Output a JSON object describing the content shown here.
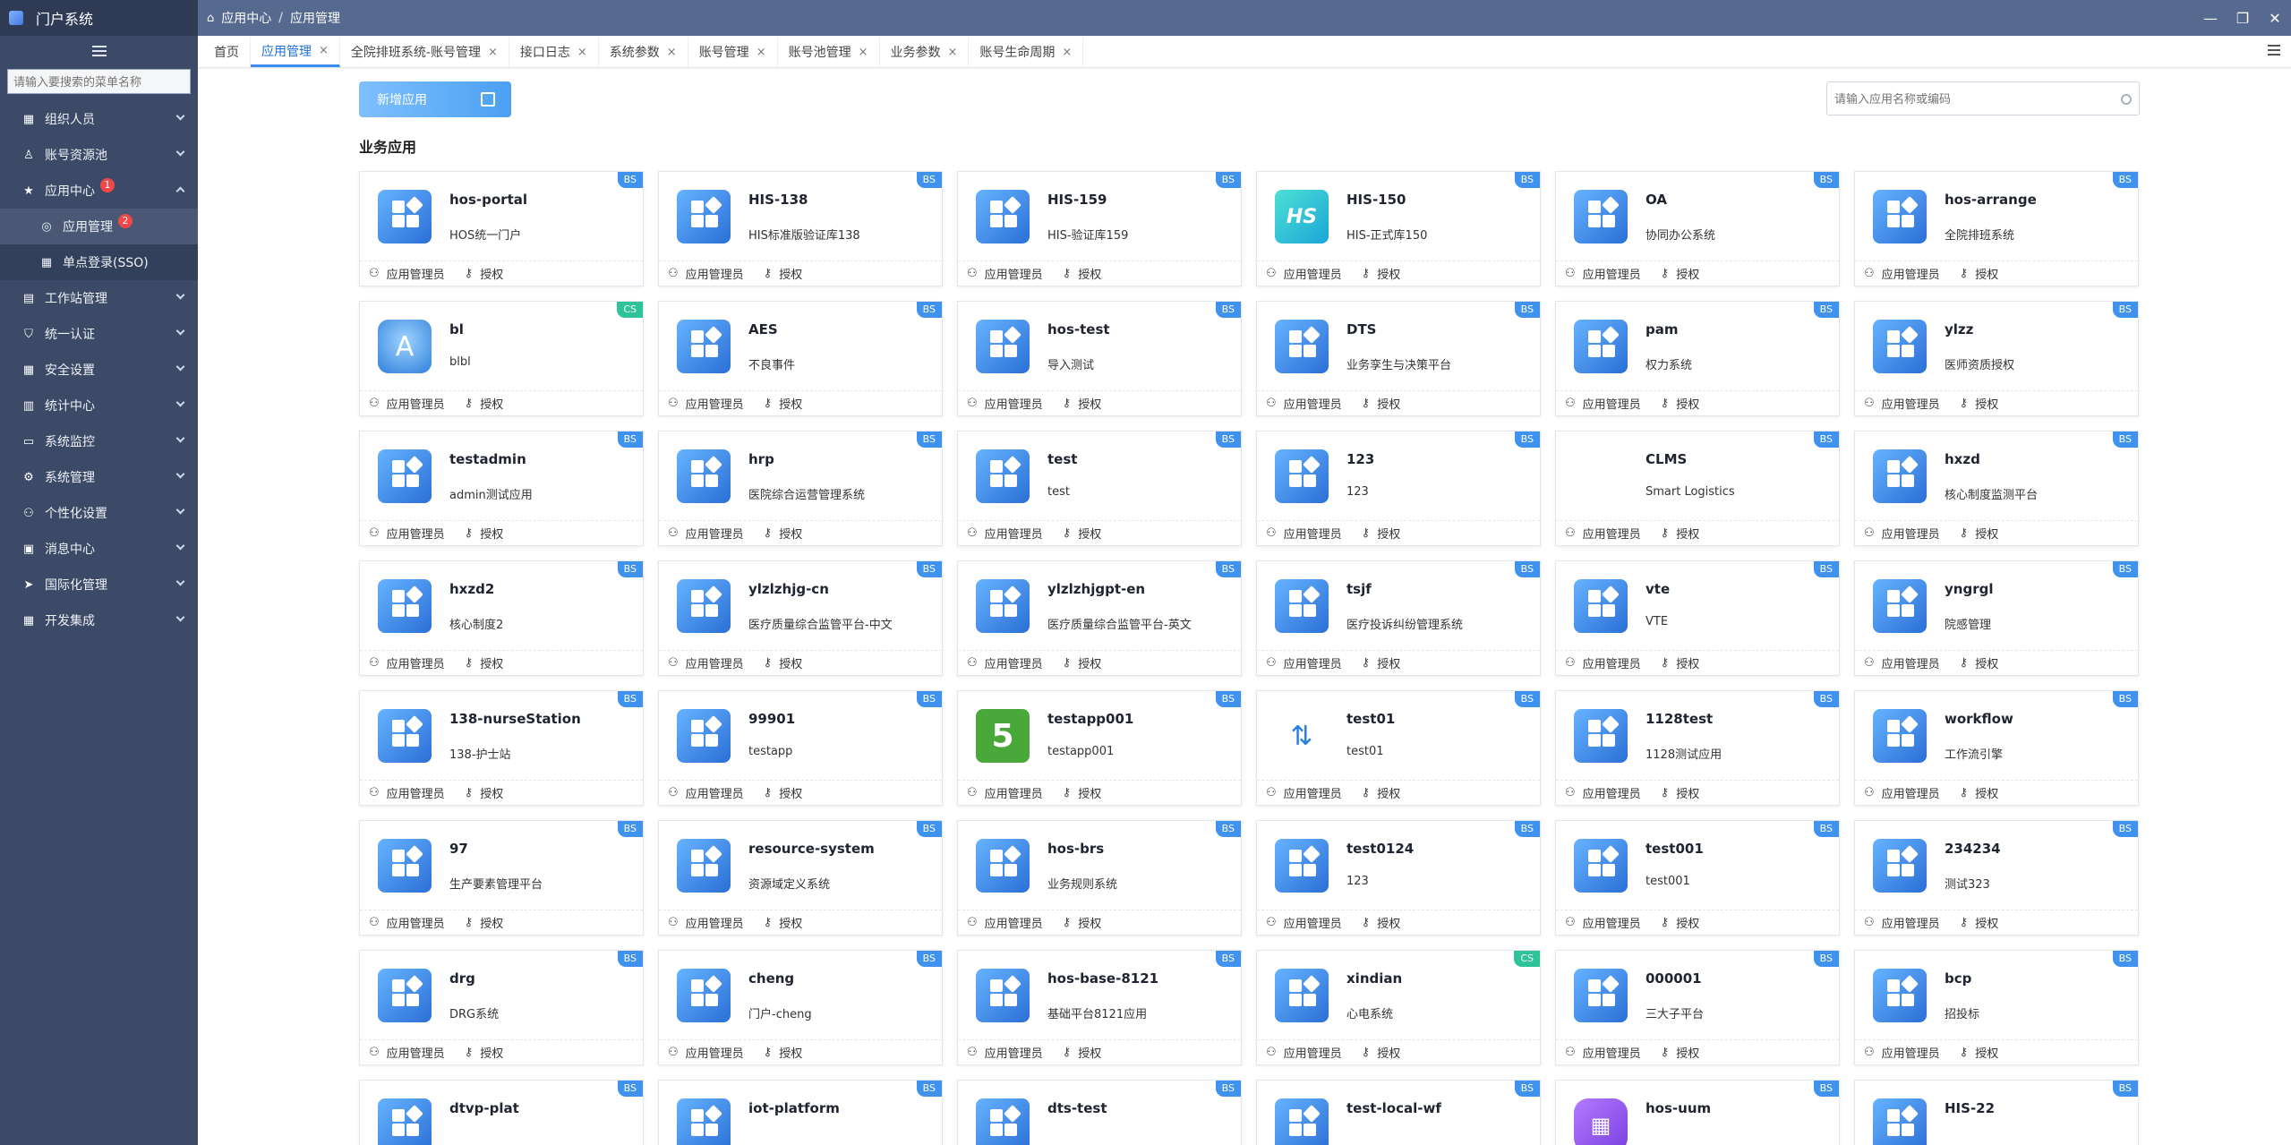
{
  "app": {
    "title": "门户系统"
  },
  "sidebar": {
    "search_placeholder": "请输入要搜索的菜单名称",
    "items": [
      {
        "label": "组织人员",
        "icon": "grid-icon"
      },
      {
        "label": "账号资源池",
        "icon": "user-icon"
      },
      {
        "label": "应用中心",
        "icon": "star-icon",
        "badge": "1"
      },
      {
        "label": "工作站管理",
        "icon": "document-icon"
      },
      {
        "label": "统一认证",
        "icon": "shield-icon"
      },
      {
        "label": "安全设置",
        "icon": "grid-icon"
      },
      {
        "label": "统计中心",
        "icon": "chart-icon"
      },
      {
        "label": "系统监控",
        "icon": "monitor-icon"
      },
      {
        "label": "系统管理",
        "icon": "settings-icon"
      },
      {
        "label": "个性化设置",
        "icon": "people-icon"
      },
      {
        "label": "消息中心",
        "icon": "inbox-icon"
      },
      {
        "label": "国际化管理",
        "icon": "send-icon"
      },
      {
        "label": "开发集成",
        "icon": "grid-icon"
      }
    ],
    "sub_items": [
      {
        "label": "应用管理",
        "icon": "app-icon",
        "badge": "2"
      },
      {
        "label": "单点登录(SSO)",
        "icon": "grid-icon"
      }
    ]
  },
  "breadcrumb": {
    "level1": "应用中心",
    "sep": "/",
    "level2": "应用管理"
  },
  "tabs": [
    {
      "label": "首页",
      "closable": false
    },
    {
      "label": "应用管理",
      "closable": true
    },
    {
      "label": "全院排班系统-账号管理",
      "closable": true
    },
    {
      "label": "接口日志",
      "closable": true
    },
    {
      "label": "系统参数",
      "closable": true
    },
    {
      "label": "账号管理",
      "closable": true
    },
    {
      "label": "账号池管理",
      "closable": true
    },
    {
      "label": "业务参数",
      "closable": true
    },
    {
      "label": "账号生命周期",
      "closable": true
    }
  ],
  "toolbar": {
    "add_label": "新增应用",
    "search_placeholder": "请输入应用名称或编码"
  },
  "section_title": "业务应用",
  "card_actions": {
    "manage": "应用管理员",
    "grant": "授权"
  },
  "apps": [
    {
      "name": "hos-portal",
      "desc": "HOS统一门户",
      "tag": "BS",
      "icon": "default"
    },
    {
      "name": "HIS-138",
      "desc": "HIS标准版验证库138",
      "tag": "BS",
      "icon": "default"
    },
    {
      "name": "HIS-159",
      "desc": "HIS-验证库159",
      "tag": "BS",
      "icon": "default"
    },
    {
      "name": "HIS-150",
      "desc": "HIS-正式库150",
      "tag": "BS",
      "icon": "his",
      "glyph": "HS"
    },
    {
      "name": "OA",
      "desc": "协同办公系统",
      "tag": "BS",
      "icon": "default"
    },
    {
      "name": "hos-arrange",
      "desc": "全院排班系统",
      "tag": "BS",
      "icon": "default"
    },
    {
      "name": "bl",
      "desc": "blbl",
      "tag": "CS",
      "icon": "app",
      "glyph": "A"
    },
    {
      "name": "AES",
      "desc": "不良事件",
      "tag": "BS",
      "icon": "default"
    },
    {
      "name": "hos-test",
      "desc": "导入测试",
      "tag": "BS",
      "icon": "default"
    },
    {
      "name": "DTS",
      "desc": "业务孪生与决策平台",
      "tag": "BS",
      "icon": "default"
    },
    {
      "name": "pam",
      "desc": "权力系统",
      "tag": "BS",
      "icon": "default"
    },
    {
      "name": "ylzz",
      "desc": "医师资质授权",
      "tag": "BS",
      "icon": "default"
    },
    {
      "name": "testadmin",
      "desc": "admin测试应用",
      "tag": "BS",
      "icon": "default"
    },
    {
      "name": "hrp",
      "desc": "医院综合运营管理系统",
      "tag": "BS",
      "icon": "default"
    },
    {
      "name": "test",
      "desc": "test",
      "tag": "BS",
      "icon": "default"
    },
    {
      "name": "123",
      "desc": "123",
      "tag": "BS",
      "icon": "default"
    },
    {
      "name": "CLMS",
      "desc": "Smart Logistics",
      "tag": "BS",
      "icon": "blank"
    },
    {
      "name": "hxzd",
      "desc": "核心制度监测平台",
      "tag": "BS",
      "icon": "default"
    },
    {
      "name": "hxzd2",
      "desc": "核心制度2",
      "tag": "BS",
      "icon": "default"
    },
    {
      "name": "ylzlzhjg-cn",
      "desc": "医疗质量综合监管平台-中文",
      "tag": "BS",
      "icon": "default"
    },
    {
      "name": "ylzlzhjgpt-en",
      "desc": "医疗质量综合监管平台-英文",
      "tag": "BS",
      "icon": "default"
    },
    {
      "name": "tsjf",
      "desc": "医疗投诉纠纷管理系统",
      "tag": "BS",
      "icon": "default"
    },
    {
      "name": "vte",
      "desc": "VTE",
      "tag": "BS",
      "icon": "default"
    },
    {
      "name": "yngrgl",
      "desc": "院感管理",
      "tag": "BS",
      "icon": "default"
    },
    {
      "name": "138-nurseStation",
      "desc": "138-护士站",
      "tag": "BS",
      "icon": "default"
    },
    {
      "name": "99901",
      "desc": "testapp",
      "tag": "BS",
      "icon": "default"
    },
    {
      "name": "testapp001",
      "desc": "testapp001",
      "tag": "BS",
      "icon": "green",
      "glyph": "5"
    },
    {
      "name": "test01",
      "desc": "test01",
      "tag": "BS",
      "icon": "arrows",
      "glyph": "⇅"
    },
    {
      "name": "1128test",
      "desc": "1128测试应用",
      "tag": "BS",
      "icon": "default"
    },
    {
      "name": "workflow",
      "desc": "工作流引擎",
      "tag": "BS",
      "icon": "default"
    },
    {
      "name": "97",
      "desc": "生产要素管理平台",
      "tag": "BS",
      "icon": "default"
    },
    {
      "name": "resource-system",
      "desc": "资源域定义系统",
      "tag": "BS",
      "icon": "default"
    },
    {
      "name": "hos-brs",
      "desc": "业务规则系统",
      "tag": "BS",
      "icon": "default"
    },
    {
      "name": "test0124",
      "desc": "123",
      "tag": "BS",
      "icon": "default"
    },
    {
      "name": "test001",
      "desc": "test001",
      "tag": "BS",
      "icon": "default"
    },
    {
      "name": "234234",
      "desc": "测试323",
      "tag": "BS",
      "icon": "default"
    },
    {
      "name": "drg",
      "desc": "DRG系统",
      "tag": "BS",
      "icon": "default"
    },
    {
      "name": "cheng",
      "desc": "门户-cheng",
      "tag": "BS",
      "icon": "default"
    },
    {
      "name": "hos-base-8121",
      "desc": "基础平台8121应用",
      "tag": "BS",
      "icon": "default"
    },
    {
      "name": "xindian",
      "desc": "心电系统",
      "tag": "CS",
      "icon": "default"
    },
    {
      "name": "000001",
      "desc": "三大子平台",
      "tag": "BS",
      "icon": "default"
    },
    {
      "name": "bcp",
      "desc": "招投标",
      "tag": "BS",
      "icon": "default"
    },
    {
      "name": "dtvp-plat",
      "desc": "",
      "tag": "BS",
      "icon": "default"
    },
    {
      "name": "iot-platform",
      "desc": "",
      "tag": "BS",
      "icon": "default"
    },
    {
      "name": "dts-test",
      "desc": "",
      "tag": "BS",
      "icon": "default"
    },
    {
      "name": "test-local-wf",
      "desc": "",
      "tag": "BS",
      "icon": "default"
    },
    {
      "name": "hos-uum",
      "desc": "",
      "tag": "BS",
      "icon": "purple",
      "glyph": "▦"
    },
    {
      "name": "HIS-22",
      "desc": "",
      "tag": "BS",
      "icon": "default"
    }
  ],
  "colors": {
    "sidebar": "#3c4a68",
    "topbar": "#56698f",
    "accent": "#3f93ef",
    "cs_tag": "#2fc39a",
    "badge": "#f04848"
  }
}
